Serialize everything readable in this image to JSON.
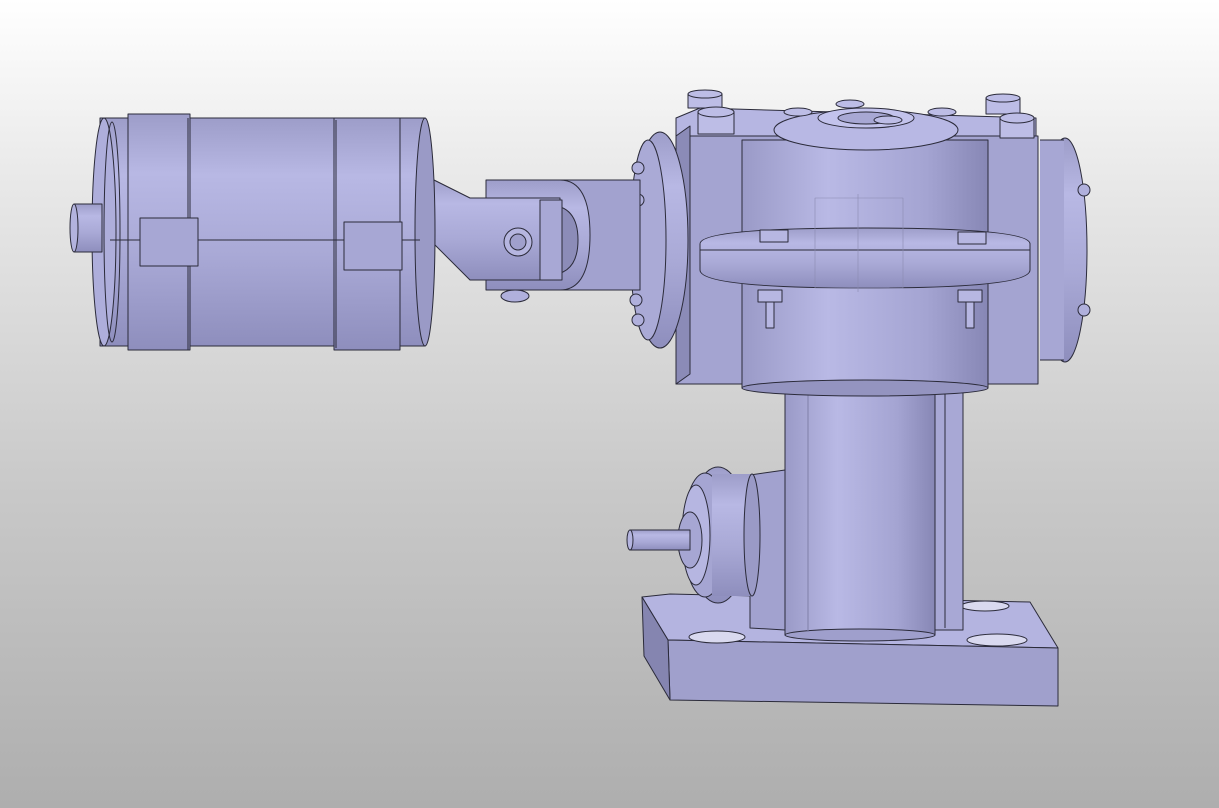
{
  "viewer": {
    "background_top": "#ffffff",
    "background_bottom": "#aeaeae",
    "part_color": "#a9a9d6",
    "edge_color": "#2b2b3a"
  },
  "model": {
    "components": [
      "motor",
      "universal-joint",
      "gearbox",
      "column",
      "side-shaft",
      "base-plate"
    ]
  }
}
